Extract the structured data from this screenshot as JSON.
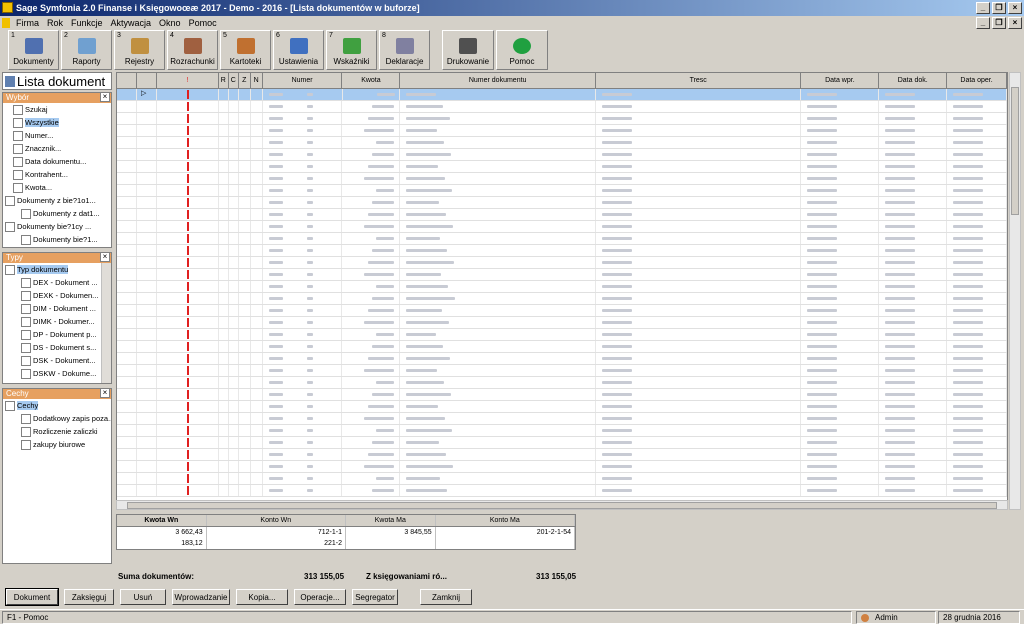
{
  "window": {
    "title": "Sage Symfonia 2.0 Finanse i Księgowoœæ 2017 - Demo - 2016 - [Lista dokumentów w buforze]"
  },
  "menu": [
    "Firma",
    "Rok",
    "Funkcje",
    "Aktywacja",
    "Okno",
    "Pomoc"
  ],
  "toolbar": [
    {
      "key": "1",
      "label": "Dokumenty",
      "icon": "documents-icon"
    },
    {
      "key": "2",
      "label": "Raporty",
      "icon": "reports-icon"
    },
    {
      "key": "3",
      "label": "Rejestry",
      "icon": "registers-icon"
    },
    {
      "key": "4",
      "label": "Rozrachunki",
      "icon": "settlements-icon"
    },
    {
      "key": "5",
      "label": "Kartoteki",
      "icon": "cards-icon"
    },
    {
      "key": "6",
      "label": "Ustawienia",
      "icon": "tools-icon"
    },
    {
      "key": "7",
      "label": "Wskaźniki",
      "icon": "chart-icon"
    },
    {
      "key": "8",
      "label": "Deklaracje",
      "icon": "declarations-icon"
    },
    {
      "key": "",
      "label": "Drukowanie",
      "icon": "printer-icon"
    },
    {
      "key": "",
      "label": "Pomoc",
      "icon": "help-icon"
    }
  ],
  "left": {
    "title": "Lista dokument",
    "wybor": {
      "title": "Wybór",
      "items": [
        "Szukaj",
        "Wszystkie",
        "Numer...",
        "Znacznik...",
        "Data dokumentu...",
        "Kontrahent...",
        "Kwota...",
        "Dokumenty z bie?1o1...",
        "Dokumenty z dat1...",
        "Dokumenty bie?1cy ...",
        "Dokumenty bie?1..."
      ]
    },
    "typy": {
      "title": "Typy",
      "items": [
        "Typ dokumentu",
        "DEX - Dokument ...",
        "DEXK - Dokumen...",
        "DIM - Dokument ...",
        "DIMK - Dokumer...",
        "DP - Dokument p...",
        "DS - Dokument s...",
        "DSK - Dokument...",
        "DSKW - Dokume..."
      ]
    },
    "cechy": {
      "title": "Cechy",
      "items": [
        "Cechy",
        "Dodatkowy zapis poza...",
        "Rozliczenie zaliczki",
        "zakupy biurowe"
      ]
    }
  },
  "grid": {
    "headers": [
      "",
      "",
      "!",
      "R",
      "C",
      "Z",
      "N",
      "Numer",
      "Kwota",
      "Numer dokumentu",
      "Tresc",
      "Data wpr.",
      "Data dok.",
      "Data oper."
    ],
    "rows": 34
  },
  "sub": {
    "headers": [
      "Kwota Wn",
      "Konto Wn",
      "Kwota Ma",
      "Konto Ma"
    ],
    "rows": [
      [
        "3 662,43",
        "712-1-1",
        "3 845,55",
        "201-2-1-54"
      ],
      [
        "183,12",
        "221-2",
        "",
        ""
      ]
    ]
  },
  "summary": {
    "label": "Suma dokumentów:",
    "total": "313 155,05",
    "label2": "Z księgowaniami ró...",
    "total2": "313 155,05"
  },
  "buttons": [
    "Dokument",
    "Zaksięguj",
    "Usuń",
    "Wprowadzanie",
    "Kopia...",
    "Operacje...",
    "Segregator",
    "Zamknij"
  ],
  "status": {
    "help": "F1 - Pomoc",
    "user": "Admin",
    "date": "28 grudnia 2016"
  }
}
